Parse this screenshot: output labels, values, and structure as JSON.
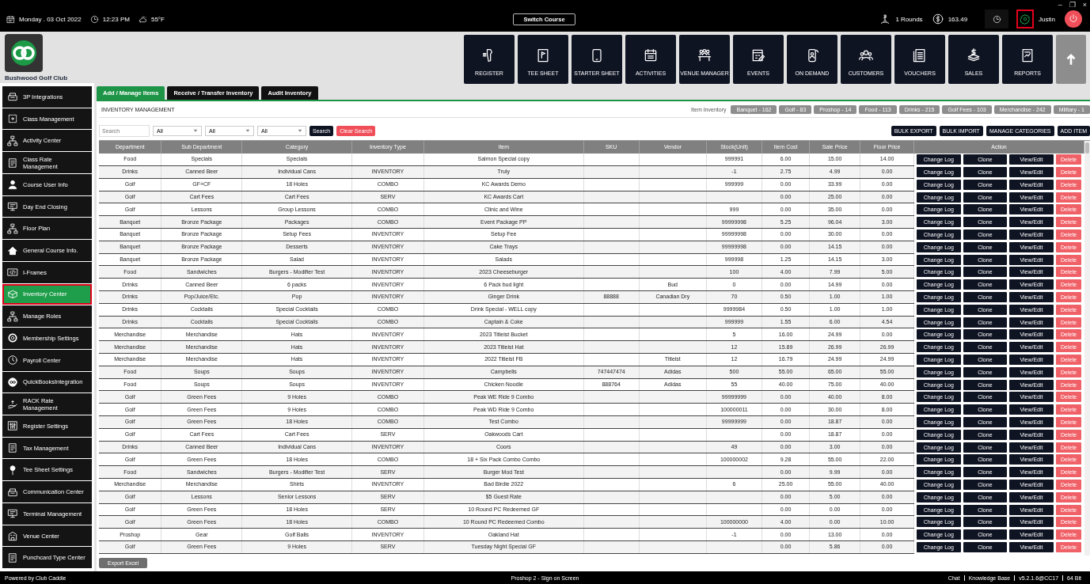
{
  "top_bar": {
    "date": "Monday . 03 Oct 2022",
    "time": "12:23 PM",
    "weather": "55°F",
    "switch_course": "Switch Course",
    "rounds": "1 Rounds",
    "balance": "163.49",
    "user": "Justin",
    "settings_highlighted": true,
    "window_controls": [
      "–",
      "❐",
      "×"
    ]
  },
  "club": {
    "name": "Bushwood Golf Club"
  },
  "nav": [
    {
      "label": "REGISTER"
    },
    {
      "label": "TEE SHEET"
    },
    {
      "label": "STARTER SHEET"
    },
    {
      "label": "ACTIVITIES"
    },
    {
      "label": "VENUE MANAGER"
    },
    {
      "label": "EVENTS"
    },
    {
      "label": "ON DEMAND"
    },
    {
      "label": "CUSTOMERS"
    },
    {
      "label": "VOUCHERS"
    },
    {
      "label": "SALES"
    },
    {
      "label": "REPORTS"
    }
  ],
  "sidebar": {
    "items": [
      {
        "label": "3P Integrations",
        "selected": false,
        "highlighted": false
      },
      {
        "label": "Class Management",
        "selected": false,
        "highlighted": false
      },
      {
        "label": "Activity Center",
        "selected": false,
        "highlighted": false
      },
      {
        "label": "Class Rate Management",
        "selected": false,
        "highlighted": false
      },
      {
        "label": "Course User Info",
        "selected": false,
        "highlighted": false
      },
      {
        "label": "Day End Closing",
        "selected": false,
        "highlighted": false
      },
      {
        "label": "Floor Plan",
        "selected": false,
        "highlighted": false
      },
      {
        "label": "General Course Info.",
        "selected": false,
        "highlighted": false
      },
      {
        "label": "I-Frames",
        "selected": false,
        "highlighted": false
      },
      {
        "label": "Inventory Center",
        "selected": true,
        "highlighted": true
      },
      {
        "label": "Manage Roles",
        "selected": false,
        "highlighted": false
      },
      {
        "label": "Membership Settings",
        "selected": false,
        "highlighted": false
      },
      {
        "label": "Payroll Center",
        "selected": false,
        "highlighted": false
      },
      {
        "label": "QuickBooksIntegration",
        "selected": false,
        "highlighted": false
      },
      {
        "label": "RACK Rate Management",
        "selected": false,
        "highlighted": false
      },
      {
        "label": "Register Settings",
        "selected": false,
        "highlighted": false
      },
      {
        "label": "Tax Management",
        "selected": false,
        "highlighted": false
      },
      {
        "label": "Tee Sheet Settings",
        "selected": false,
        "highlighted": false
      },
      {
        "label": "Communication Center",
        "selected": false,
        "highlighted": false
      },
      {
        "label": "Terminal Management",
        "selected": false,
        "highlighted": false
      },
      {
        "label": "Venue Center",
        "selected": false,
        "highlighted": false
      },
      {
        "label": "Punchcard Type Center",
        "selected": false,
        "highlighted": false
      }
    ]
  },
  "tabs": [
    {
      "label": "Add / Manage Items",
      "selected": true
    },
    {
      "label": "Receive / Transfer Inventory",
      "selected": false
    },
    {
      "label": "Audit Inventory",
      "selected": false
    }
  ],
  "panel": {
    "title": "INVENTORY MANAGEMENT",
    "inventory_label": "Item Inventory",
    "inventory_counts": [
      "Banquet - 162",
      "Golf - 83",
      "Proshop - 14",
      "Food - 113",
      "Drinks - 215",
      "Golf Fees - 103",
      "Merchandise - 242",
      "Military - 1"
    ]
  },
  "filters": {
    "search_placeholder": "Search",
    "selects": [
      "All",
      "All",
      "All"
    ],
    "search_button": "Search",
    "clear_button": "Clear Search",
    "actions": [
      "BULK EXPORT",
      "BULK IMPORT",
      "MANAGE CATEGORIES",
      "ADD ITEM"
    ]
  },
  "table": {
    "columns": [
      "Department",
      "Sub Department",
      "Category",
      "Inventory Type",
      "Item",
      "SKU",
      "Vendor",
      "Stock(Unit)",
      "Item Cost",
      "Sale Price",
      "Floor Price",
      "Action"
    ],
    "rows": [
      {
        "cells": [
          "Food",
          "Specials",
          "Specials",
          null,
          "Salmon Special copy",
          null,
          null,
          "999991",
          "6.00",
          "15.00",
          "14.00"
        ],
        "actions": [
          "Change Log",
          "Clone",
          "View/Edit",
          "Delete"
        ]
      },
      {
        "cells": [
          "Drinks",
          "Canned Beer",
          "Individual Cans",
          "INVENTORY",
          "Truly",
          null,
          null,
          "-1",
          "2.75",
          "4.99",
          "0.00"
        ],
        "actions": [
          "Change Log",
          "Clone",
          "View/Edit",
          "Delete"
        ]
      },
      {
        "cells": [
          "Golf",
          "GF+CF",
          "18 Holes",
          "COMBO",
          "KC Awards Demo",
          null,
          null,
          "999999",
          "0.00",
          "33.99",
          "0.00"
        ],
        "actions": [
          "Change Log",
          "Clone",
          "View/Edit",
          "Delete"
        ]
      },
      {
        "cells": [
          "Golf",
          "Cart Fees",
          "Cart Fees",
          "SERV",
          "KC Awards Cart",
          null,
          null,
          null,
          "0.00",
          "25.00",
          "0.00"
        ],
        "actions": [
          "Change Log",
          "Clone",
          "View/Edit",
          "Delete"
        ]
      },
      {
        "cells": [
          "Golf",
          "Lessons",
          "Group Lessons",
          "COMBO",
          "Clinic and Wine",
          null,
          null,
          "999",
          "0.00",
          "35.00",
          "0.00"
        ],
        "actions": [
          "Change Log",
          "Clone",
          "View/Edit",
          "Delete"
        ]
      },
      {
        "cells": [
          "Banquet",
          "Bronze Package",
          "Packages",
          "COMBO",
          "Event Package PP",
          null,
          null,
          "99999998",
          "5.25",
          "96.04",
          "3.00"
        ],
        "actions": [
          "Change Log",
          "Clone",
          "View/Edit",
          "Delete"
        ]
      },
      {
        "cells": [
          "Banquet",
          "Bronze Package",
          "Setup Fees",
          "INVENTORY",
          "Setup Fee",
          null,
          null,
          "99999998",
          "0.00",
          "30.00",
          "0.00"
        ],
        "actions": [
          "Change Log",
          "Clone",
          "View/Edit",
          "Delete"
        ]
      },
      {
        "cells": [
          "Banquet",
          "Bronze Package",
          "Desserts",
          "INVENTORY",
          "Cake Trays",
          null,
          null,
          "99999998",
          "0.00",
          "14.15",
          "0.00"
        ],
        "actions": [
          "Change Log",
          "Clone",
          "View/Edit",
          "Delete"
        ]
      },
      {
        "cells": [
          "Banquet",
          "Bronze Package",
          "Salad",
          "INVENTORY",
          "Salads",
          null,
          null,
          "999998",
          "1.25",
          "14.15",
          "3.00"
        ],
        "actions": [
          "Change Log",
          "Clone",
          "View/Edit",
          "Delete"
        ]
      },
      {
        "cells": [
          "Food",
          "Sandwiches",
          "Burgers - Modifier Test",
          "INVENTORY",
          "2023 Cheeseburger",
          null,
          null,
          "100",
          "4.00",
          "7.99",
          "5.00"
        ],
        "actions": [
          "Change Log",
          "Clone",
          "View/Edit",
          "Delete"
        ]
      },
      {
        "cells": [
          "Drinks",
          "Canned Beer",
          "6 packs",
          "INVENTORY",
          "6 Pack bud light",
          null,
          "Bud",
          "0",
          "0.00",
          "14.99",
          "0.00"
        ],
        "actions": [
          "Change Log",
          "Clone",
          "View/Edit",
          "Delete"
        ]
      },
      {
        "cells": [
          "Drinks",
          "Pop/Juice/Etc.",
          "Pop",
          "INVENTORY",
          "Ginger Drink",
          "88888",
          "Canadian Dry",
          "70",
          "0.50",
          "1.00",
          "1.00"
        ],
        "actions": [
          "Change Log",
          "Clone",
          "View/Edit",
          "Delete"
        ]
      },
      {
        "cells": [
          "Drinks",
          "Cocktails",
          "Special Cocktails",
          "COMBO",
          "Drink Special - WELL copy",
          null,
          null,
          "9999984",
          "0.50",
          "1.00",
          "1.00"
        ],
        "actions": [
          "Change Log",
          "Clone",
          "View/Edit",
          "Delete"
        ]
      },
      {
        "cells": [
          "Drinks",
          "Cocktails",
          "Special Cocktails",
          "COMBO",
          "Captain & Coke",
          null,
          null,
          "999999",
          "1.55",
          "6.00",
          "4.54"
        ],
        "actions": [
          "Change Log",
          "Clone",
          "View/Edit",
          "Delete"
        ]
      },
      {
        "cells": [
          "Merchandise",
          "Merchandise",
          "Hats",
          "INVENTORY",
          "2023 Titleist Bucket",
          null,
          null,
          "5",
          "16.00",
          "24.99",
          "0.00"
        ],
        "actions": [
          "Change Log",
          "Clone",
          "View/Edit",
          "Delete"
        ]
      },
      {
        "cells": [
          "Merchandise",
          "Merchandise",
          "Hats",
          "INVENTORY",
          "2023 Titleist Hat",
          null,
          null,
          "12",
          "15.89",
          "26.99",
          "26.99"
        ],
        "actions": [
          "Change Log",
          "Clone",
          "View/Edit",
          "Delete"
        ]
      },
      {
        "cells": [
          "Merchandise",
          "Merchandise",
          "Hats",
          "INVENTORY",
          "2022 Titleist FB",
          null,
          "Titleist",
          "12",
          "16.79",
          "24.99",
          "24.99"
        ],
        "actions": [
          "Change Log",
          "Clone",
          "View/Edit",
          "Delete"
        ]
      },
      {
        "cells": [
          "Food",
          "Soups",
          "Soups",
          "INVENTORY",
          "Campbells",
          "747447474",
          "Adidas",
          "500",
          "55.00",
          "65.00",
          "55.00"
        ],
        "actions": [
          "Change Log",
          "Clone",
          "View/Edit",
          "Delete"
        ]
      },
      {
        "cells": [
          "Food",
          "Soups",
          "Soups",
          "INVENTORY",
          "Chicken Noodle",
          "888764",
          "Adidas",
          "55",
          "40.00",
          "75.00",
          "40.00"
        ],
        "actions": [
          "Change Log",
          "Clone",
          "View/Edit",
          "Delete"
        ]
      },
      {
        "cells": [
          "Golf",
          "Green Fees",
          "9 Holes",
          "COMBO",
          "Peak WE Ride 9 Combo",
          null,
          null,
          "99999999",
          "0.00",
          "40.00",
          "8.00"
        ],
        "actions": [
          "Change Log",
          "Clone",
          "View/Edit",
          "Delete"
        ]
      },
      {
        "cells": [
          "Golf",
          "Green Fees",
          "9 Holes",
          "COMBO",
          "Peak WD Ride 9 Combo",
          null,
          null,
          "100000011",
          "0.00",
          "30.00",
          "8.00"
        ],
        "actions": [
          "Change Log",
          "Clone",
          "View/Edit",
          "Delete"
        ]
      },
      {
        "cells": [
          "Golf",
          "Green Fees",
          "18 Holes",
          "COMBO",
          "Test Combo",
          null,
          null,
          "99999999",
          "0.00",
          "18.87",
          "0.00"
        ],
        "actions": [
          "Change Log",
          "Clone",
          "View/Edit",
          "Delete"
        ]
      },
      {
        "cells": [
          "Golf",
          "Cart Fees",
          "Cart Fees",
          "SERV",
          "Oakwoods Cart",
          null,
          null,
          null,
          "0.00",
          "18.87",
          "0.00"
        ],
        "actions": [
          "Change Log",
          "Clone",
          "View/Edit",
          "Delete"
        ]
      },
      {
        "cells": [
          "Drinks",
          "Canned Beer",
          "Individual Cans",
          "INVENTORY",
          "Coors",
          null,
          null,
          "49",
          "0.00",
          "3.00",
          "0.00"
        ],
        "actions": [
          "Change Log",
          "Clone",
          "View/Edit",
          "Delete"
        ]
      },
      {
        "cells": [
          "Golf",
          "Green Fees",
          "18 Holes",
          "COMBO",
          "18 + Six Pack Combo Combo",
          null,
          null,
          "100000002",
          "9.28",
          "55.00",
          "22.00"
        ],
        "actions": [
          "Change Log",
          "Clone",
          "View/Edit",
          "Delete"
        ]
      },
      {
        "cells": [
          "Food",
          "Sandwiches",
          "Burgers - Modifier Test",
          "SERV",
          "Burger Mod Test",
          null,
          null,
          null,
          "0.00",
          "9.99",
          "0.00"
        ],
        "actions": [
          "Change Log",
          "Clone",
          "View/Edit",
          "Delete"
        ]
      },
      {
        "cells": [
          "Merchandise",
          "Merchandise",
          "Shirts",
          "INVENTORY",
          "Bad Birdie 2022",
          null,
          null,
          "6",
          "25.00",
          "55.00",
          "40.00"
        ],
        "actions": [
          "Change Log",
          "Clone",
          "View/Edit",
          "Delete"
        ]
      },
      {
        "cells": [
          "Golf",
          "Lessons",
          "Senior Lessons",
          "SERV",
          "$5 Guest Rate",
          null,
          null,
          null,
          "0.00",
          "5.00",
          "0.00"
        ],
        "actions": [
          "Change Log",
          "Clone",
          "View/Edit",
          "Delete"
        ]
      },
      {
        "cells": [
          "Golf",
          "Green Fees",
          "18 Holes",
          "SERV",
          "10 Round PC Redeemed GF",
          null,
          null,
          null,
          "0.00",
          "0.00",
          "0.00"
        ],
        "actions": [
          "Change Log",
          "Clone",
          "View/Edit",
          "Delete"
        ]
      },
      {
        "cells": [
          "Golf",
          "Green Fees",
          "18 Holes",
          "COMBO",
          "10 Round PC Redeemed Combo",
          null,
          null,
          "100000000",
          "4.00",
          "0.00",
          "10.00"
        ],
        "actions": [
          "Change Log",
          "Clone",
          "View/Edit",
          "Delete"
        ]
      },
      {
        "cells": [
          "Proshop",
          "Gear",
          "Golf Balls",
          "INVENTORY",
          "Oakland Hat",
          null,
          null,
          "-1",
          "0.00",
          "13.00",
          "0.00"
        ],
        "actions": [
          "Change Log",
          "Clone",
          "View/Edit",
          "Delete"
        ]
      },
      {
        "cells": [
          "Golf",
          "Green Fees",
          "9 Holes",
          "SERV",
          "Tuesday Night Special GF",
          null,
          null,
          null,
          "0.00",
          "5.86",
          "0.00"
        ],
        "actions": [
          "Change Log",
          "Clone",
          "View/Edit",
          "Delete"
        ]
      }
    ]
  },
  "export_button": "Export Excel",
  "footer": {
    "left": "Powered by Club Caddie",
    "center": "Proshop 2 - Sign on Screen",
    "right": [
      "Chat",
      "Knowledge Base",
      "v5.2.1.6@CC17",
      "64 Bit"
    ]
  }
}
